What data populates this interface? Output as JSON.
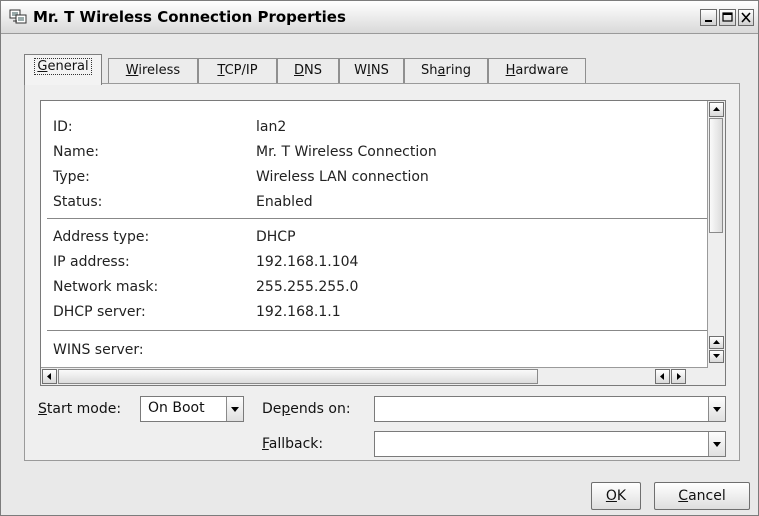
{
  "window": {
    "title": "Mr. T Wireless Connection Properties",
    "icon": "network-connection-icon"
  },
  "tabs": [
    {
      "pre": "",
      "u": "G",
      "post": "eneral",
      "active": true
    },
    {
      "pre": "",
      "u": "W",
      "post": "ireless",
      "active": false
    },
    {
      "pre": "",
      "u": "T",
      "post": "CP/IP",
      "active": false
    },
    {
      "pre": "",
      "u": "D",
      "post": "NS",
      "active": false
    },
    {
      "pre": "W",
      "u": "I",
      "post": "NS",
      "active": false
    },
    {
      "pre": "Sh",
      "u": "a",
      "post": "ring",
      "active": false
    },
    {
      "pre": "",
      "u": "H",
      "post": "ardware",
      "active": false
    }
  ],
  "properties": {
    "group1": [
      {
        "key": "ID:",
        "value": "lan2"
      },
      {
        "key": "Name:",
        "value": "Mr. T Wireless Connection"
      },
      {
        "key": "Type:",
        "value": "Wireless LAN connection"
      },
      {
        "key": "Status:",
        "value": "Enabled"
      }
    ],
    "group2": [
      {
        "key": "Address type:",
        "value": "DHCP"
      },
      {
        "key": "IP address:",
        "value": "192.168.1.104"
      },
      {
        "key": "Network mask:",
        "value": "255.255.255.0"
      },
      {
        "key": "DHCP server:",
        "value": "192.168.1.1"
      }
    ],
    "group3": [
      {
        "key": "WINS server:",
        "value": ""
      }
    ]
  },
  "start_mode": {
    "label_pre": "",
    "label_u": "S",
    "label_post": "tart mode:",
    "value": "On Boot"
  },
  "depends_on": {
    "label_pre": "De",
    "label_u": "p",
    "label_post": "ends on:",
    "value": ""
  },
  "fallback": {
    "label_pre": "",
    "label_u": "F",
    "label_post": "allback:",
    "value": ""
  },
  "buttons": {
    "ok_u": "O",
    "ok_post": "K",
    "cancel_u": "C",
    "cancel_post": "ancel"
  }
}
